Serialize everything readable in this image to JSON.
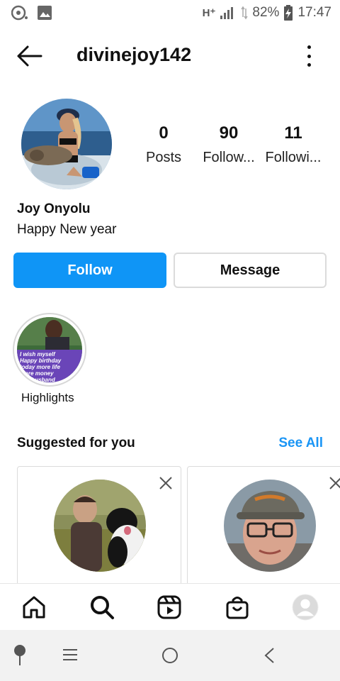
{
  "status": {
    "network": "H⁺",
    "battery": "82%",
    "time": "17:47"
  },
  "header": {
    "username": "divinejoy142"
  },
  "profile": {
    "stats": [
      {
        "value": "0",
        "label": "Posts"
      },
      {
        "value": "90",
        "label": "Follow..."
      },
      {
        "value": "11",
        "label": "Followi..."
      }
    ],
    "display_name": "Joy Onyolu",
    "bio": "Happy New year"
  },
  "actions": {
    "follow": "Follow",
    "message": "Message"
  },
  "highlight": {
    "label": "Highlights",
    "thumb_text": [
      "I wish myself",
      "Happy birthday",
      "today more life",
      "more money",
      "and husband"
    ]
  },
  "suggestions": {
    "title": "Suggested for you",
    "see_all": "See All"
  },
  "colors": {
    "primary": "#0f95f6",
    "link": "#1a95f5"
  },
  "icons": {
    "bottom_nav": [
      "home-icon",
      "search-icon",
      "reels-icon",
      "shop-icon",
      "profile-avatar"
    ],
    "system_nav": [
      "assistant-icon",
      "recents-icon",
      "home-circle-icon",
      "back-chevron-icon"
    ]
  }
}
